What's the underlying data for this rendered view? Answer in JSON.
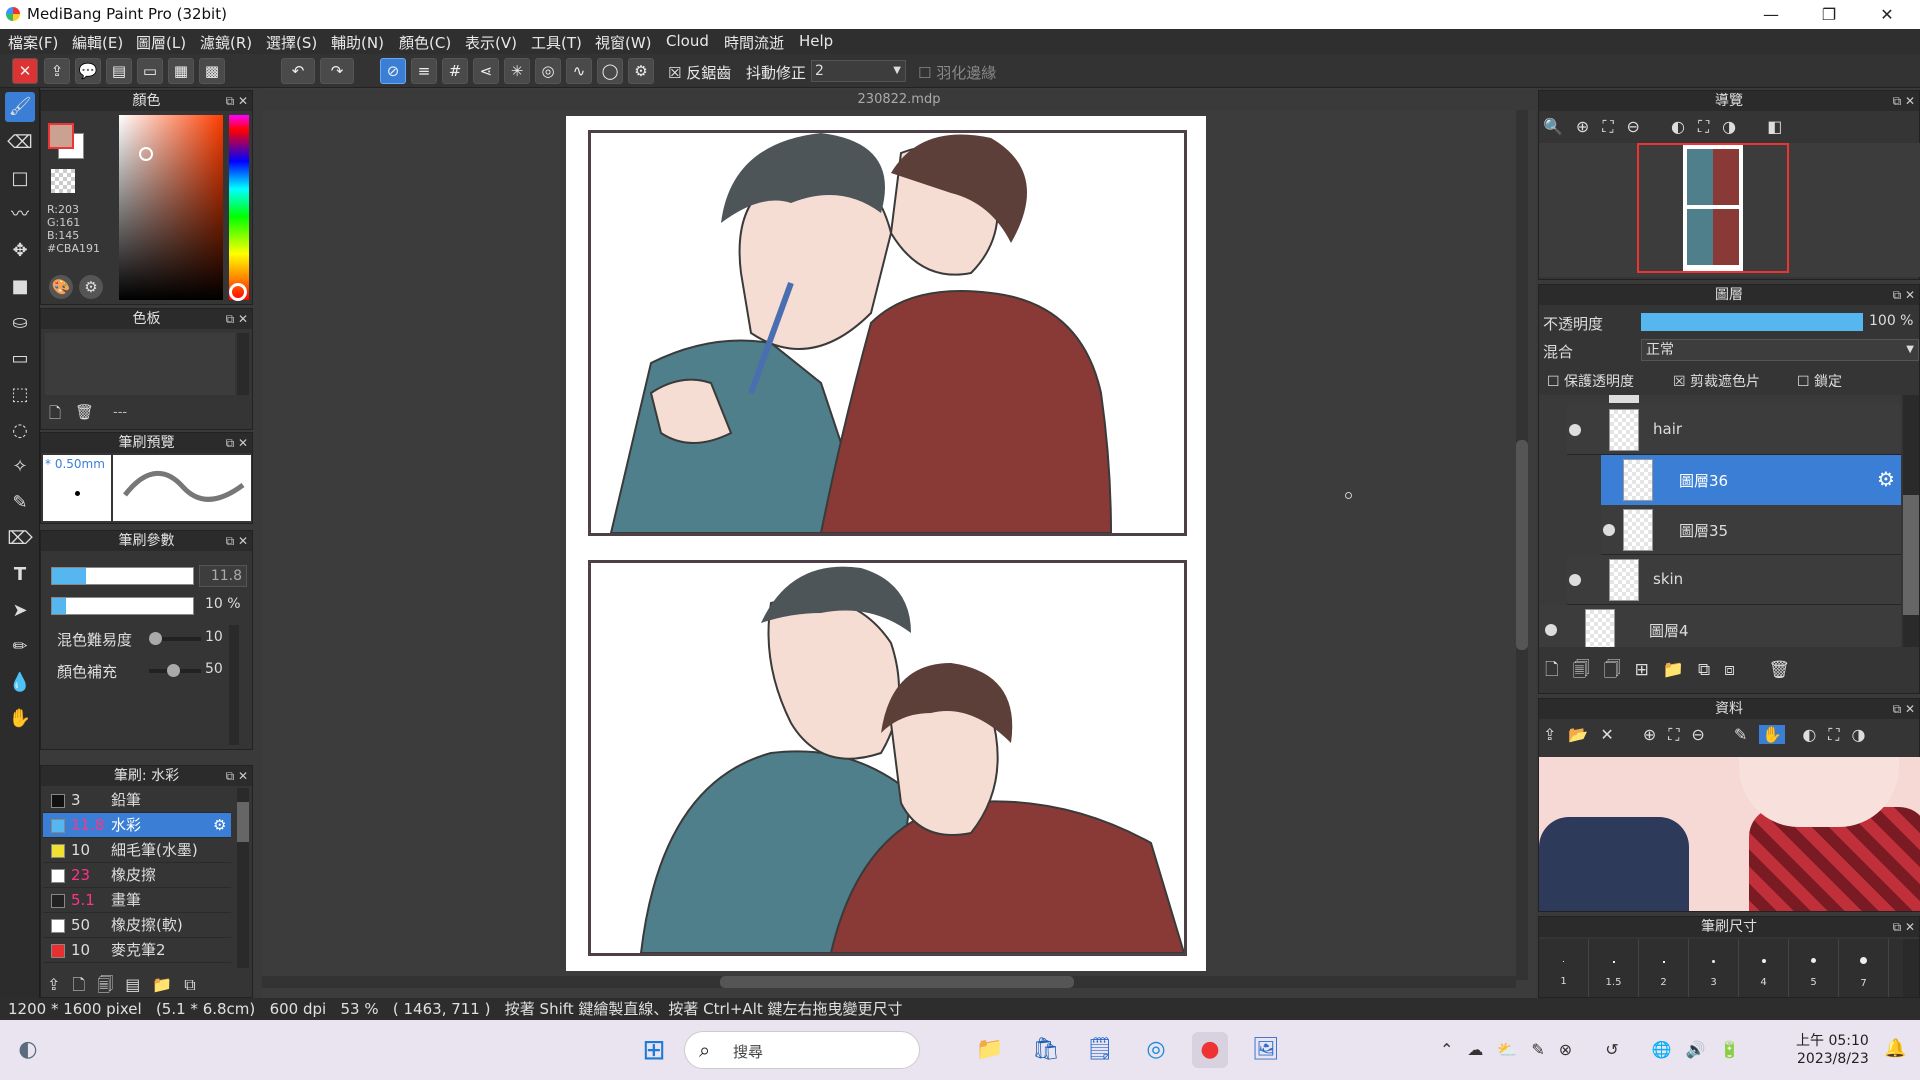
{
  "window": {
    "title": "MediBang Paint Pro (32bit)",
    "min": "—",
    "max": "❐",
    "close": "✕"
  },
  "menu": [
    "檔案(F)",
    "編輯(E)",
    "圖層(L)",
    "濾鏡(R)",
    "選擇(S)",
    "輔助(N)",
    "顏色(C)",
    "表示(V)",
    "工具(T)",
    "視窗(W)",
    "Cloud",
    "時間流逝",
    "Help"
  ],
  "toolbar": {
    "antialias": "反鋸齒",
    "stabilizer": "抖動修正",
    "stabilizer_value": "2",
    "feather": "羽化邊緣"
  },
  "color_panel": {
    "title": "顏色",
    "r": "R:203",
    "g": "G:161",
    "b": "B:145",
    "hex": "#CBA191",
    "fg": "#cba191"
  },
  "palette_panel": {
    "title": "色板",
    "dash": "---"
  },
  "brush_preview": {
    "title": "筆刷預覽",
    "size": "* 0.50mm"
  },
  "brush_params": {
    "title": "筆刷參數",
    "size_value": "11.8",
    "opacity_value": "10 %",
    "blend_label": "混色難易度",
    "blend_value": "10",
    "fill_label": "顏色補充",
    "fill_value": "50"
  },
  "brush_list": {
    "title": "筆刷: 水彩",
    "items": [
      {
        "size": "3",
        "name": "鉛筆",
        "color": "#111111"
      },
      {
        "size": "11.8",
        "name": "水彩",
        "color": "#56b6f0"
      },
      {
        "size": "10",
        "name": "細毛筆(水墨)",
        "color": "#f0e030"
      },
      {
        "size": "23",
        "name": "橡皮擦",
        "color": "#ffffff"
      },
      {
        "size": "5.1",
        "name": "畫筆",
        "color": "#222222"
      },
      {
        "size": "50",
        "name": "橡皮擦(軟)",
        "color": "#ffffff"
      },
      {
        "size": "10",
        "name": "麥克筆2",
        "color": "#e83030"
      }
    ]
  },
  "document": {
    "tab": "230822.mdp"
  },
  "navigator": {
    "title": "導覽"
  },
  "layers": {
    "title": "圖層",
    "opacity_label": "不透明度",
    "opacity_value": "100 %",
    "opacity": 1.0,
    "blend_label": "混合",
    "blend_value": "正常",
    "protect_alpha": "保護透明度",
    "clipping": "剪裁遮色片",
    "lock": "鎖定",
    "rows": [
      {
        "name": "hair"
      },
      {
        "name": "圖層36"
      },
      {
        "name": "圖層35"
      },
      {
        "name": "skin"
      },
      {
        "name": "圖層4"
      }
    ]
  },
  "materials": {
    "title": "資料"
  },
  "brush_size": {
    "title": "筆刷尺寸",
    "values": [
      "1",
      "1.5",
      "2",
      "3",
      "4",
      "5",
      "7"
    ]
  },
  "status": {
    "text": "1200 * 1600 pixel   (5.1 * 6.8cm)   600 dpi   53 %   ( 1463, 711 )   按著 Shift 鍵繪製直線、按著 Ctrl+Alt 鍵左右拖曳變更尺寸"
  },
  "taskbar": {
    "search": "搜尋",
    "time": "上午 05:10",
    "date": "2023/8/23"
  }
}
